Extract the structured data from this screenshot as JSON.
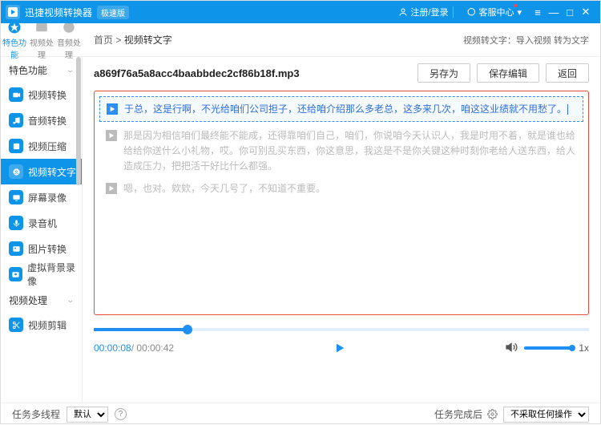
{
  "titlebar": {
    "appname": "迅捷视频转换器",
    "badge": "极速版",
    "register_login": "注册/登录",
    "support_center": "客服中心"
  },
  "modetabs": {
    "t0": "特色功能",
    "t1": "视频处理",
    "t2": "音频处理"
  },
  "breadcrumb": {
    "root": "首页",
    "sep": " > ",
    "cur": "视频转文字"
  },
  "top_right": "视频转文字：导入视频 转为文字",
  "side_groups": {
    "g0": "特色功能",
    "g1": "视频处理"
  },
  "side_items": {
    "i0": "视频转换",
    "i1": "音频转换",
    "i2": "视频压缩",
    "i3": "视频转文字",
    "i4": "屏幕录像",
    "i5": "录音机",
    "i6": "图片转换",
    "i7": "虚拟背景录像",
    "i8": "视频剪辑"
  },
  "file": {
    "name": "a869f76a5a8acc4baabbdec2cf86b18f.mp3"
  },
  "buttons": {
    "saveas": "另存为",
    "saveedit": "保存编辑",
    "back": "返回"
  },
  "transcript": {
    "line0": "于总，这是行啊，不光给咱们公司担子，还给咱介绍那么多老总，这多来几次，咱这这业绩就不用愁了。",
    "line1": "那是因为相信咱们最终能不能成，还得靠咱们自己，咱们，你说咱今天认识人，我是时用不着，就是谁也给给给你送什么小礼物，哎。你可别乱买东西，你这意思，我这是不是你关键这种时刻你老给人送东西，给人造成压力，把把活干好比什么都强。",
    "line2": "嗯，也对。欸欸，今天几号了，不知道不重要。"
  },
  "player": {
    "cur": "00:00:08",
    "sep": " / ",
    "tot": "00:00:42",
    "speed": "1x"
  },
  "footer": {
    "label": "任务多线程",
    "option": "默认",
    "complete_label": "任务完成后",
    "complete_value": "不采取任何操作"
  }
}
